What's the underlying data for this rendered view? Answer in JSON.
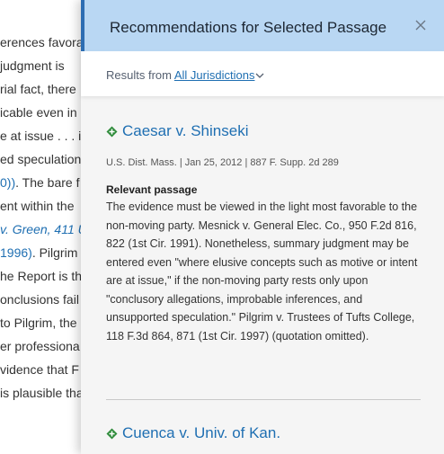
{
  "document": {
    "lines": [
      {
        "pre": "erences favora"
      },
      {
        "pre": " judgment is"
      },
      {
        "pre": "rial fact, there"
      },
      {
        "pre": "icable even in"
      },
      {
        "pre": "e at issue . . . if"
      },
      {
        "pre": "ed speculation"
      },
      {
        "link": "0))",
        "post": ". The bare f"
      },
      {
        "pre": "ent within the"
      },
      {
        "link": "v. Green, 411 U"
      },
      {
        "link": "1996)",
        "post": ". Pilgrim"
      },
      {
        "pre": "he Report is th"
      },
      {
        "pre": "onclusions fail"
      },
      {
        "pre": "to Pilgrim, the"
      },
      {
        "pre": "er professiona"
      },
      {
        "pre": "vidence that F"
      },
      {
        "pre": "is plausible tha"
      }
    ]
  },
  "panel": {
    "title": "Recommendations for Selected Passage",
    "close_icon": "close-icon",
    "results_prefix": "Results from",
    "jurisdiction_label": "All Jurisdictions"
  },
  "cases": [
    {
      "title": "Caesar v. Shinseki",
      "meta": "U.S. Dist. Mass. | Jan 25, 2012 | 887 F. Supp. 2d 289",
      "passage_label": "Relevant passage",
      "passage": "The evidence must be viewed in the light most favorable to the non-moving party. Mesnick v. General Elec. Co., 950 F.2d 816, 822 (1st Cir. 1991). Nonetheless, summary judgment may be entered even \"where elusive concepts such as motive or intent are at issue,\" if the non-moving party rests only upon \"conclusory allegations, improbable inferences, and unsupported speculation.\" Pilgrim v. Trustees of Tufts College, 118 F.3d 864, 871 (1st Cir. 1997) (quotation omitted)."
    },
    {
      "title": "Cuenca v. Univ. of Kan."
    }
  ],
  "colors": {
    "header_bg": "#b9d7f3",
    "accent": "#2d6db2",
    "link": "#1f6fb2",
    "case_icon": "#2e8b3a"
  }
}
